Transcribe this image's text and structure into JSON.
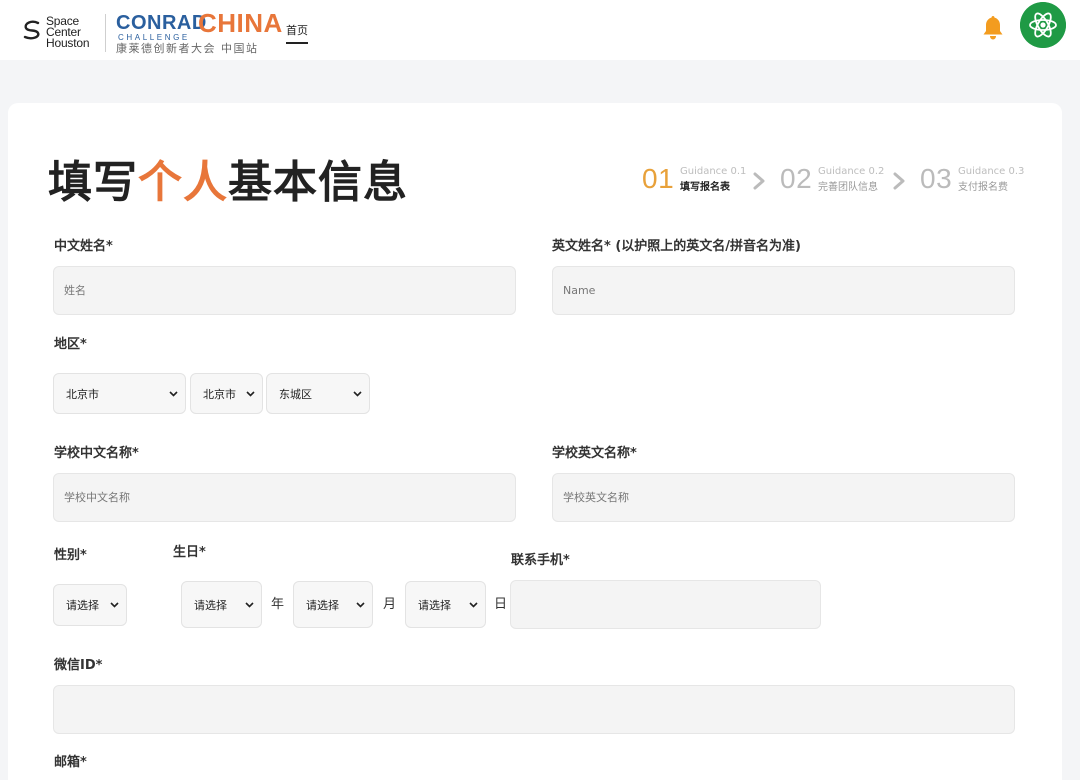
{
  "header": {
    "sch_logo_lines": [
      "Space",
      "Center",
      "Houston"
    ],
    "conrad_word": "CONRAD",
    "china_word": "CHINA",
    "challenge_word": "CHALLENGE",
    "conrad_cn": "康莱德创新者大会 中国站",
    "nav_home": "首页",
    "colors": {
      "accent": "#e8763a",
      "brand_blue": "#2a5f9e",
      "bell": "#f39c1f",
      "avatar_bg": "#1f9a45"
    },
    "icons": {
      "bell": "bell-icon",
      "avatar": "atom-avatar-icon"
    }
  },
  "title": {
    "part1": "填写",
    "highlight": "个人",
    "part2": "基本信息"
  },
  "steps": [
    {
      "num": "01",
      "guidance": "Guidance 0.1",
      "name": "填写报名表",
      "active": true
    },
    {
      "num": "02",
      "guidance": "Guidance 0.2",
      "name": "完善团队信息",
      "active": false
    },
    {
      "num": "03",
      "guidance": "Guidance 0.3",
      "name": "支付报名费",
      "active": false
    }
  ],
  "form": {
    "cn_name": {
      "label": "中文姓名*",
      "placeholder": "姓名"
    },
    "en_name": {
      "label": "英文姓名* (以护照上的英文名/拼音名为准)",
      "placeholder": "Name"
    },
    "region": {
      "label": "地区*",
      "province": "北京市",
      "city": "北京市",
      "district": "东城区"
    },
    "school_cn": {
      "label": "学校中文名称*",
      "placeholder": "学校中文名称"
    },
    "school_en": {
      "label": "学校英文名称*",
      "placeholder": "学校英文名称"
    },
    "gender": {
      "label": "性别*",
      "value": "请选择"
    },
    "birthday": {
      "label": "生日*",
      "year": "请选择",
      "year_unit": "年",
      "month": "请选择",
      "month_unit": "月",
      "day": "请选择",
      "day_unit": "日"
    },
    "phone": {
      "label": "联系手机*",
      "value": ""
    },
    "wechat": {
      "label": "微信ID*",
      "value": ""
    },
    "email": {
      "label": "邮箱*"
    }
  }
}
